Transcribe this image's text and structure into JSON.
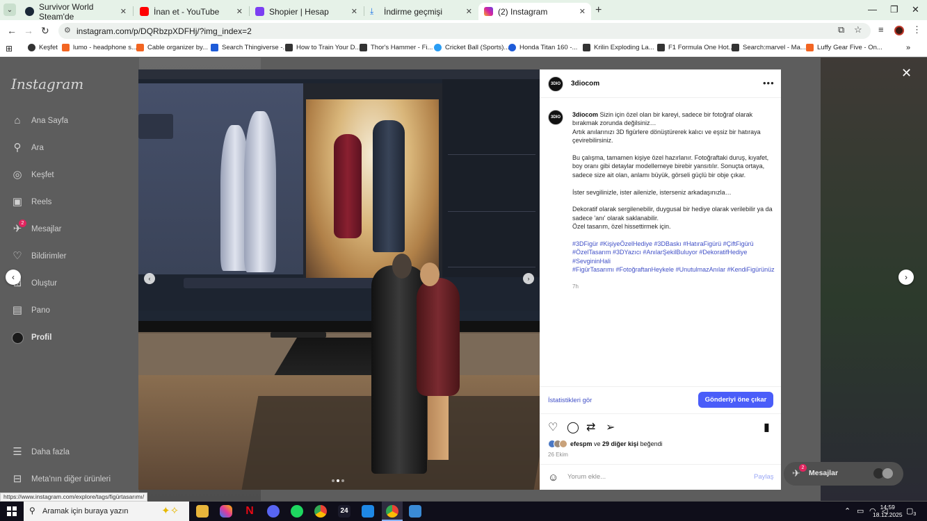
{
  "browser": {
    "tabs": [
      {
        "title": "Survivor World Steam'de",
        "color": "#1b2838"
      },
      {
        "title": "İnan et - YouTube",
        "color": "#ff0000"
      },
      {
        "title": "Shopier | Hesap",
        "color": "#7b3ff2"
      },
      {
        "title": "İndirme geçmişi",
        "color": "#1a73e8"
      },
      {
        "title": "(2) Instagram",
        "color": "#d6249f"
      }
    ],
    "url": "instagram.com/p/DQRbzpXDFHj/?img_index=2",
    "bookmarks": [
      {
        "label": "Keşfet",
        "color": "#333333"
      },
      {
        "label": "lumo - headphone s...",
        "color": "#f26522"
      },
      {
        "label": "Cable organizer by...",
        "color": "#f26522"
      },
      {
        "label": "Search Thingiverse -...",
        "color": "#1e5bd8"
      },
      {
        "label": "How to Train Your D...",
        "color": "#333333"
      },
      {
        "label": "Thor's Hammer - Fi...",
        "color": "#333333"
      },
      {
        "label": "Cricket Ball (Sports)...",
        "color": "#2a9df4"
      },
      {
        "label": "Honda Titan 160 -...",
        "color": "#1e5bd8"
      },
      {
        "label": "Krilin Exploding La...",
        "color": "#333333"
      },
      {
        "label": "F1 Formula One Hot...",
        "color": "#333333"
      },
      {
        "label": "Search:marvel - Ma...",
        "color": "#333333"
      },
      {
        "label": "Luffy Gear Five - On...",
        "color": "#f26522"
      }
    ]
  },
  "sidebar": {
    "logo": "Instagram",
    "items": [
      {
        "label": "Ana Sayfa",
        "icon": "home-icon"
      },
      {
        "label": "Ara",
        "icon": "search-icon"
      },
      {
        "label": "Keşfet",
        "icon": "compass-icon"
      },
      {
        "label": "Reels",
        "icon": "reels-icon"
      },
      {
        "label": "Mesajlar",
        "icon": "messenger-icon",
        "badge": "2"
      },
      {
        "label": "Bildirimler",
        "icon": "heart-icon"
      },
      {
        "label": "Oluştur",
        "icon": "plus-icon"
      },
      {
        "label": "Pano",
        "icon": "dashboard-icon"
      },
      {
        "label": "Profil",
        "icon": "profile-avatar"
      }
    ],
    "bottom": [
      {
        "label": "Daha fazla",
        "icon": "menu-icon"
      },
      {
        "label": "Meta'nın diğer ürünleri",
        "icon": "meta-grid-icon"
      }
    ]
  },
  "post": {
    "author": "3diocom",
    "avatar_text": "3DIO",
    "caption_intro": "Sizin için özel olan bir kareyi, sadece bir fotoğraf olarak bırakmak zorunda değilsiniz…",
    "caption_lines": [
      "Artık anılarınızı 3D figürlere dönüştürerek kalıcı ve eşsiz bir hatıraya çevirebilirsiniz.",
      "Bu çalışma, tamamen kişiye özel hazırlanır. Fotoğraftaki duruş, kıyafet, boy oranı gibi detaylar modellemeye birebir yansıtılır. Sonuçta ortaya, sadece size ait olan, anlamı büyük, görseli güçlü bir obje çıkar.",
      "İster sevgilinizle, ister ailenizle, isterseniz arkadaşınızla…",
      "Dekoratif olarak sergilenebilir, duygusal bir hediye olarak verilebilir ya da sadece 'anı' olarak saklanabilir.",
      "Özel tasarım, özel hissettirmek için."
    ],
    "hashtags_1": "#3DFigür #KişiyeÖzelHediye #3DBaskı #HatıraFigürü #ÇiftFigürü #ÖzelTasarım #3DYazıcı #AnılarŞekilBuluyor #DekoratifHediye #SevgininHali",
    "hashtags_2": "#FigürTasarımı #FotoğraftanHeykele #UnutulmazAnılar #KendiFigürünüz",
    "caption_time": "7h",
    "insights_label": "İstatistikleri gör",
    "boost_label": "Gönderiyi öne çıkar",
    "liked_by_user": "efespm",
    "liked_by_text": " ve ",
    "liked_by_count": "29 diğer kişi",
    "liked_by_suffix": " beğendi",
    "date": "26 Ekim",
    "comment_placeholder": "Yorum ekle...",
    "post_label": "Paylaş",
    "carousel_index": 2,
    "carousel_total": 3
  },
  "messages_float": {
    "label": "Mesajlar",
    "badge": "2"
  },
  "status_url": "https://www.instagram.com/explore/tags/figürtasarımı/",
  "taskbar": {
    "search_placeholder": "Aramak için buraya yazın",
    "time": "14:59",
    "date": "18.12.2025",
    "notifications": "3"
  }
}
